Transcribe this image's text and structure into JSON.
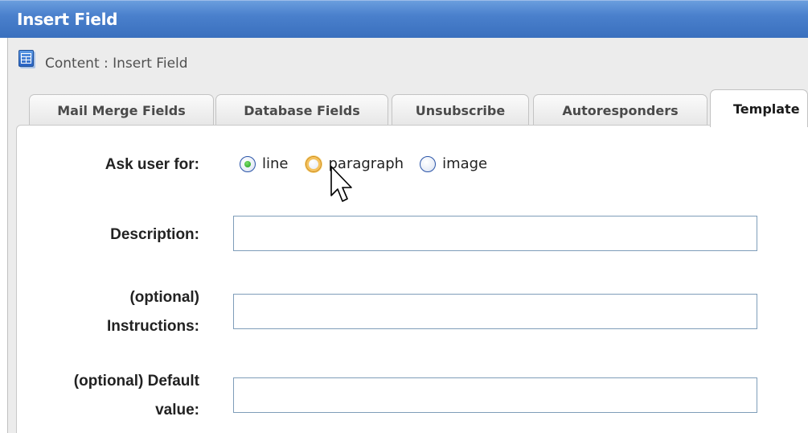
{
  "window": {
    "title": "Insert Field",
    "breadcrumb_icon": "content-grid-icon",
    "breadcrumb": "Content : Insert Field"
  },
  "tabs": [
    {
      "label": "Mail Merge Fields",
      "active": false
    },
    {
      "label": "Database Fields",
      "active": false
    },
    {
      "label": "Unsubscribe",
      "active": false
    },
    {
      "label": "Autoresponders",
      "active": false
    },
    {
      "label": "Template",
      "active": true
    }
  ],
  "form": {
    "ask_user_label": "Ask user for:",
    "ask_user_options": [
      {
        "label": "line",
        "selected": true
      },
      {
        "label": "paragraph",
        "selected": false
      },
      {
        "label": "image",
        "selected": false
      }
    ],
    "description_label": "Description:",
    "description_value": "",
    "instructions_label_1": "(optional)",
    "instructions_label_2": "Instructions:",
    "instructions_value": "",
    "default_label_1": "(optional) Default",
    "default_label_2": "value:",
    "default_value": ""
  },
  "colors": {
    "title_bar": "#4a80cc",
    "radio_selected": "#1c9b1c",
    "radio_hover": "#f4c25d",
    "input_border": "#7f9db9"
  },
  "cursor_icon": "arrow-pointer-icon"
}
